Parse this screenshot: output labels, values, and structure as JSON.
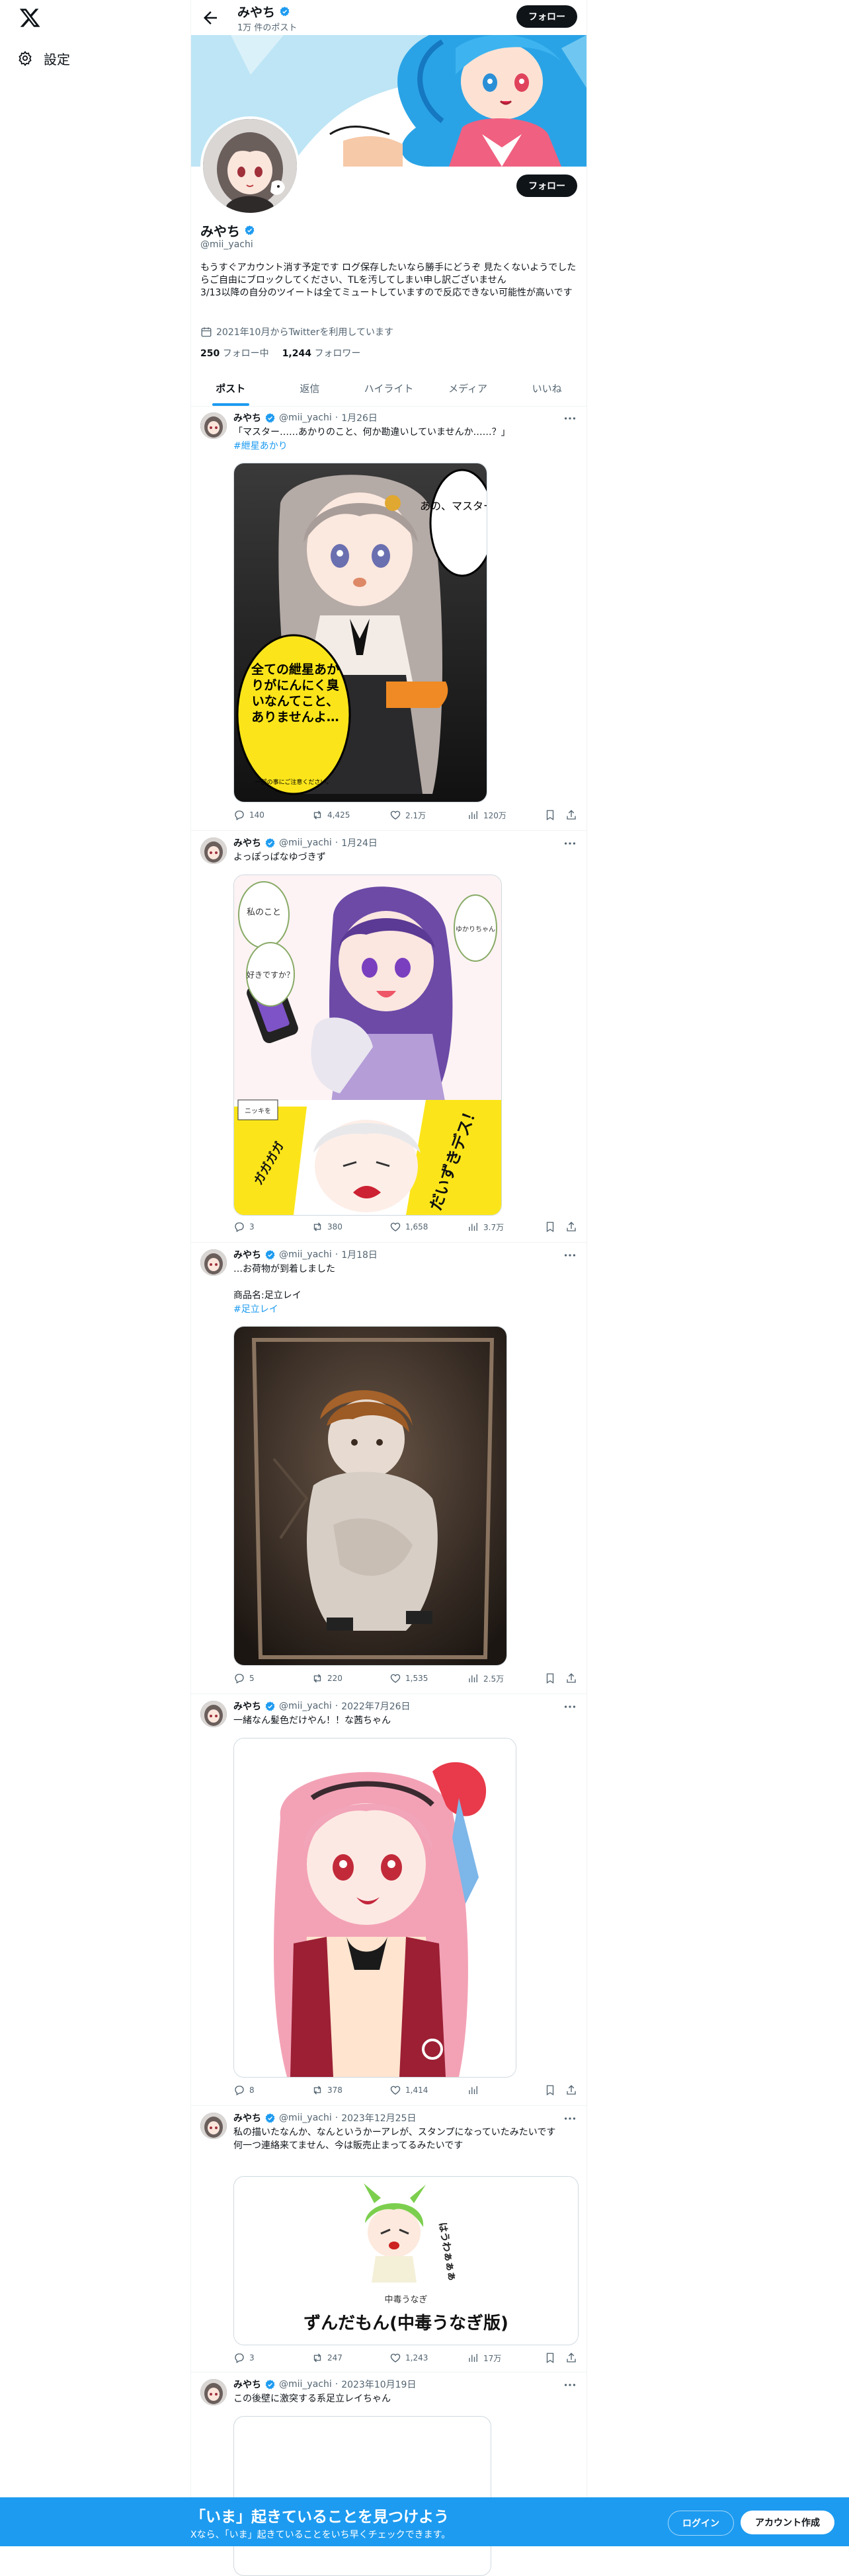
{
  "nav": {
    "settings_label": "設定"
  },
  "header": {
    "name": "みやち",
    "post_count": "1万 件のポスト",
    "follow_label": "フォロー"
  },
  "profile": {
    "name": "みやち",
    "handle": "@mii_yachi",
    "bio": "もうすぐアカウント消す予定です ログ保存したいなら勝手にどうぞ 見たくないようでしたらご自由にブロックしてください、TLを汚してしまい申し訳ございません\n3/13以降の自分のツイートは全てミュートしていますので反応できない可能性が高いです",
    "joined": "2021年10月からTwitterを利用しています",
    "following_count": "250",
    "following_label": "フォロー中",
    "followers_count": "1,244",
    "followers_label": "フォロワー",
    "follow_label": "フォロー"
  },
  "tabs": [
    "ポスト",
    "返信",
    "ハイライト",
    "メディア",
    "いいね"
  ],
  "tweets": [
    {
      "name": "みやち",
      "handle": "@mii_yachi",
      "date": "1月26日",
      "text": "「マスター……あかりのこと、何か勘違いしていませんか……？」",
      "tags": [
        "#紲星あかり"
      ],
      "replies": "140",
      "retweets": "4,425",
      "likes": "2.1万",
      "views": "120万",
      "media_text": {
        "bubble1": "あの、マスター？",
        "bubble2": "全ての紲星あかりがにんにく臭いなんてこと、ありませんよ…",
        "small": "一部の事にご注意ください。"
      }
    },
    {
      "name": "みやち",
      "handle": "@mii_yachi",
      "date": "1月24日",
      "text": "よっぽっぱなゆづきず",
      "tags": [],
      "replies": "3",
      "retweets": "380",
      "likes": "1,658",
      "views": "3.7万",
      "media_text": {
        "b1": "私のこと",
        "b2": "好きですか？",
        "b3": "ゆかりちゃん",
        "b4": "だいずきデス！",
        "b5": "ガガガガ",
        "b6": "ニッキを"
      }
    },
    {
      "name": "みやち",
      "handle": "@mii_yachi",
      "date": "1月18日",
      "text": "…お荷物が到着しました\n\n商品名:足立レイ",
      "tags": [
        "#足立レイ"
      ],
      "replies": "5",
      "retweets": "220",
      "likes": "1,535",
      "views": "2.5万"
    },
    {
      "name": "みやち",
      "handle": "@mii_yachi",
      "date": "2022年7月26日",
      "text": "一緒なん髪色だけやん！！な茜ちゃん",
      "tags": [],
      "replies": "8",
      "retweets": "378",
      "likes": "1,414",
      "views": ""
    },
    {
      "name": "みやち",
      "handle": "@mii_yachi",
      "date": "2023年12月25日",
      "text": "私の描いたなんか、なんというかーアレが、スタンプになっていたみたいです\n何一つ連絡来てません、今は販売止まってるみたいです",
      "tags": [],
      "replies": "3",
      "retweets": "247",
      "likes": "1,243",
      "views": "17万",
      "card": {
        "small": "中毒うなぎ",
        "big": "ずんだもん(中毒うなぎ版)",
        "sticker": "はうわぁぁぁ"
      }
    },
    {
      "name": "みやち",
      "handle": "@mii_yachi",
      "date": "2023年10月19日",
      "text": "この後壁に激突する系足立レイちゃん",
      "tags": [],
      "replies": "",
      "retweets": "",
      "likes": "",
      "views": ""
    }
  ],
  "bottom_bar": {
    "title": "「いま」起きていることを見つけよう",
    "subtitle": "Xなら、「いま」起きていることをいち早くチェックできます。",
    "login_label": "ログイン",
    "signup_label": "アカウント作成"
  }
}
